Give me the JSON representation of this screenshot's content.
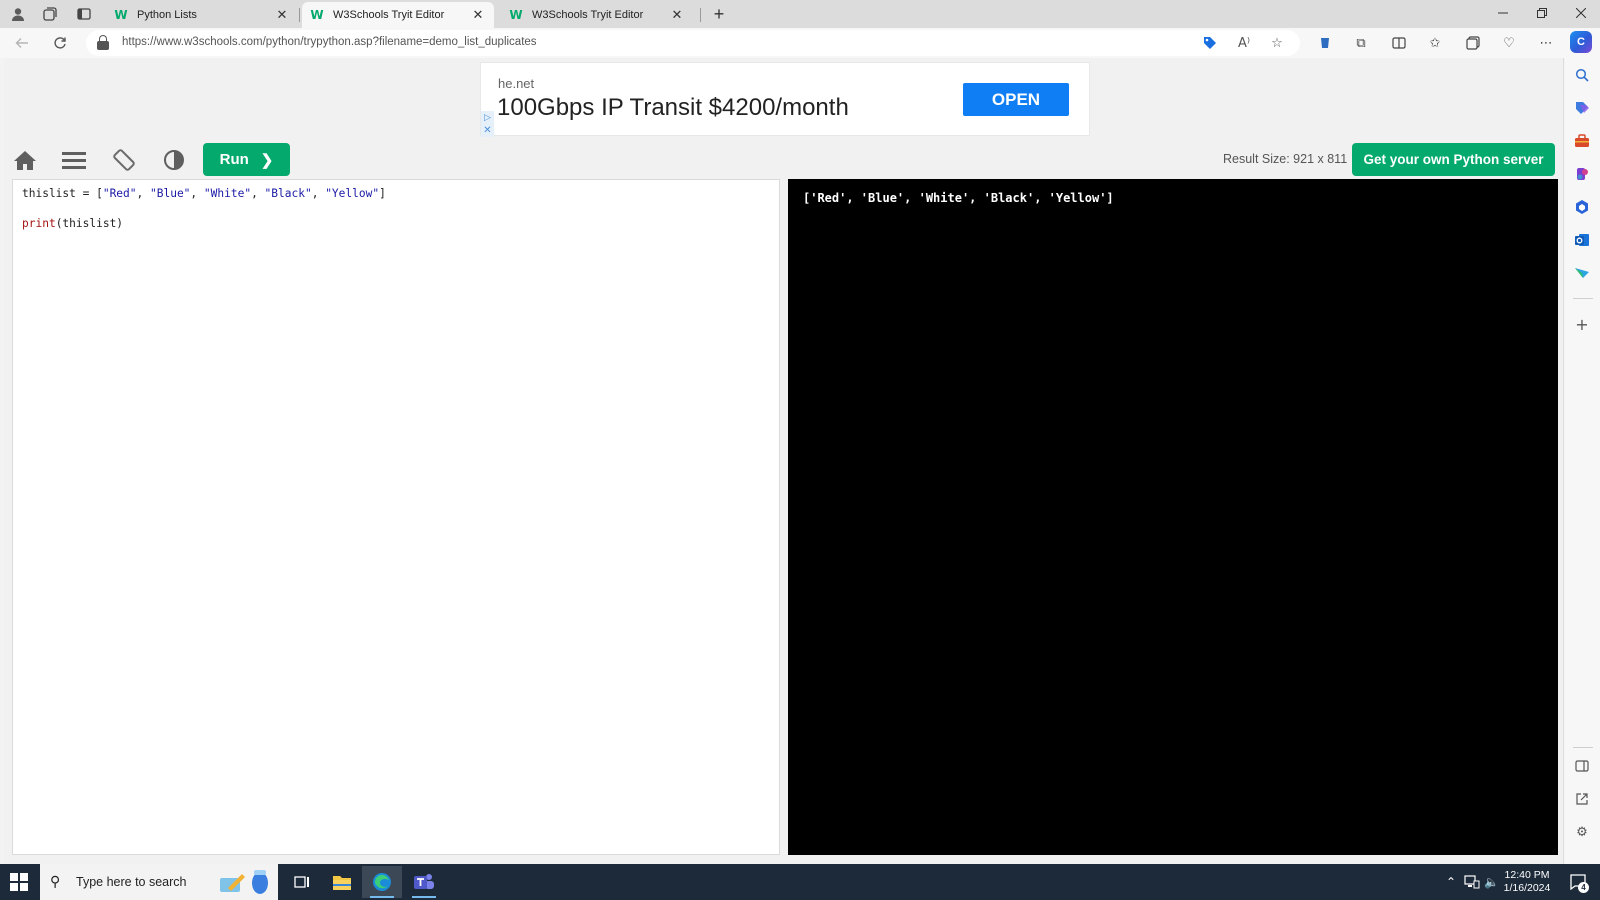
{
  "browser": {
    "tabs": [
      {
        "title": "Python Lists",
        "favicon": "w3schools-icon",
        "active": false
      },
      {
        "title": "W3Schools Tryit Editor",
        "favicon": "w3schools-icon",
        "active": true
      },
      {
        "title": "W3Schools Tryit Editor",
        "favicon": "w3schools-icon",
        "active": false
      }
    ],
    "favicon_glyph": "W",
    "tab_close_glyph": "✕",
    "new_tab_glyph": "+",
    "url": "https://www.w3schools.com/python/trypython.asp?filename=demo_list_duplicates",
    "accent_color": "#04aa6d"
  },
  "ad": {
    "domain": "he.net",
    "headline": "100Gbps IP Transit $4200/month",
    "cta": "OPEN",
    "cta_color": "#0f7ef5"
  },
  "toolbar": {
    "run_label": "Run",
    "result_size": "Result Size: 921 x 811",
    "server_button": "Get your own Python server"
  },
  "editor": {
    "line1": {
      "prefix": "thislist = [",
      "items": [
        "\"Red\"",
        "\"Blue\"",
        "\"White\"",
        "\"Black\"",
        "\"Yellow\""
      ],
      "separator": ", ",
      "suffix": "]"
    },
    "line2": {
      "fn": "print",
      "args": "(thislist)"
    }
  },
  "result": {
    "output": "['Red', 'Blue', 'White', 'Black', 'Yellow']"
  },
  "taskbar": {
    "search_placeholder": "Type here to search",
    "time": "12:40 PM",
    "date": "1/16/2024",
    "notification_count": "4",
    "color": "#1c2a3a"
  }
}
